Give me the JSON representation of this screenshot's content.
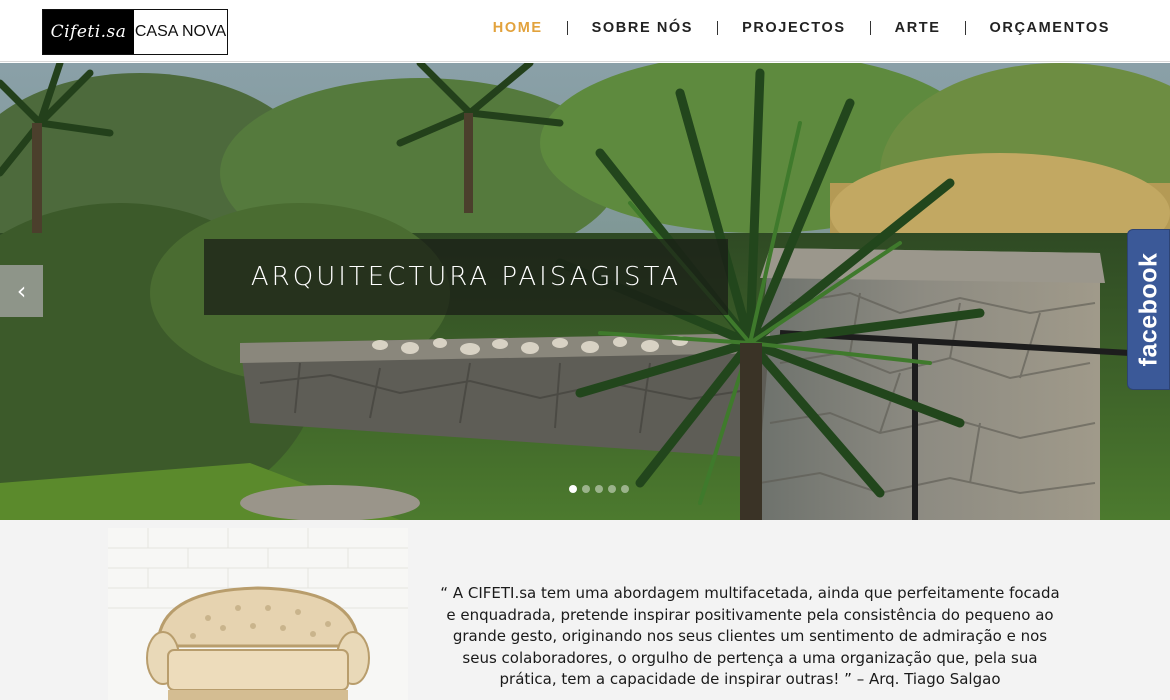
{
  "brand": {
    "name": "Cifeti.sa",
    "tagline": "CASA NOVA"
  },
  "nav": {
    "items": [
      {
        "label": "HOME",
        "active": true
      },
      {
        "label": "SOBRE NÓS",
        "active": false
      },
      {
        "label": "PROJECTOS",
        "active": false
      },
      {
        "label": "ARTE",
        "active": false
      },
      {
        "label": "ORÇAMENTOS",
        "active": false
      }
    ]
  },
  "hero": {
    "caption": "ARQUITECTURA PAISAGISTA",
    "prev_arrow": "‹",
    "slide_count": 5,
    "active_slide": 1
  },
  "social": {
    "facebook_label": "facebook"
  },
  "intro": {
    "quote": "“ A CIFETI.sa tem uma abordagem multifacetada, ainda que perfeitamente focada e enquadrada, pretende inspirar positivamente pela consistência do pequeno ao grande gesto, originando nos seus clientes um sentimento de admiração e nos seus colaboradores, o orgulho de pertença a uma organização que, pela sua prática, tem a capacidade de inspirar outras! ” – Arq. Tiago Salgao"
  },
  "colors": {
    "accent": "#e2a23c",
    "facebook": "#3b5998",
    "text": "#222222"
  }
}
